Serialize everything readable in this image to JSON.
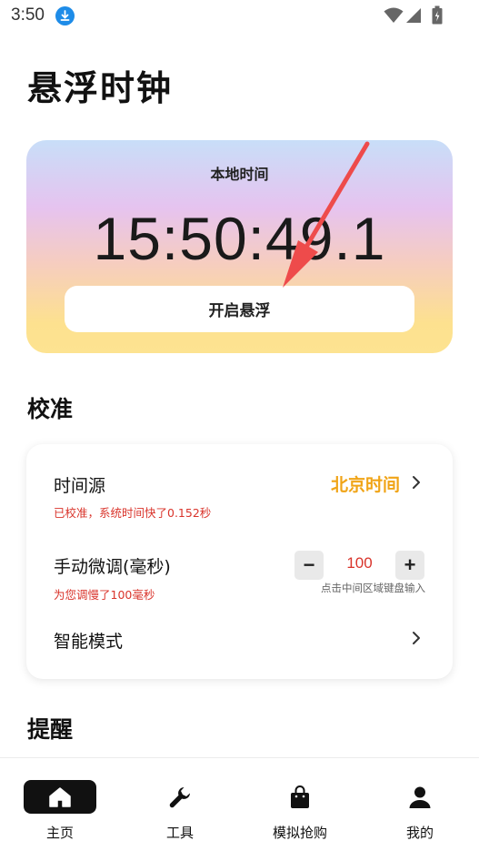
{
  "status_bar": {
    "time": "3:50"
  },
  "page": {
    "title": "悬浮时钟"
  },
  "clock": {
    "label": "本地时间",
    "time": "15:50:49.1",
    "float_button": "开启悬浮"
  },
  "sections": {
    "calibration": "校准",
    "reminder": "提醒"
  },
  "calibration": {
    "source_label": "时间源",
    "source_value": "北京时间",
    "source_note": "已校准，系统时间快了0.152秒",
    "manual_label": "手动微调(毫秒)",
    "manual_note": "为您调慢了100毫秒",
    "manual_value": "100",
    "minus": "−",
    "plus": "+",
    "manual_hint": "点击中间区域键盘输入",
    "smart_label": "智能模式"
  },
  "colors": {
    "accent": "#f0a417",
    "warning": "#d9342b",
    "active_tab": "#111111"
  },
  "tabs": [
    {
      "label": "主页",
      "icon": "home-icon",
      "active": true
    },
    {
      "label": "工具",
      "icon": "wrench-icon",
      "active": false
    },
    {
      "label": "模拟抢购",
      "icon": "shopping-bag-icon",
      "active": false
    },
    {
      "label": "我的",
      "icon": "user-icon",
      "active": false
    }
  ]
}
